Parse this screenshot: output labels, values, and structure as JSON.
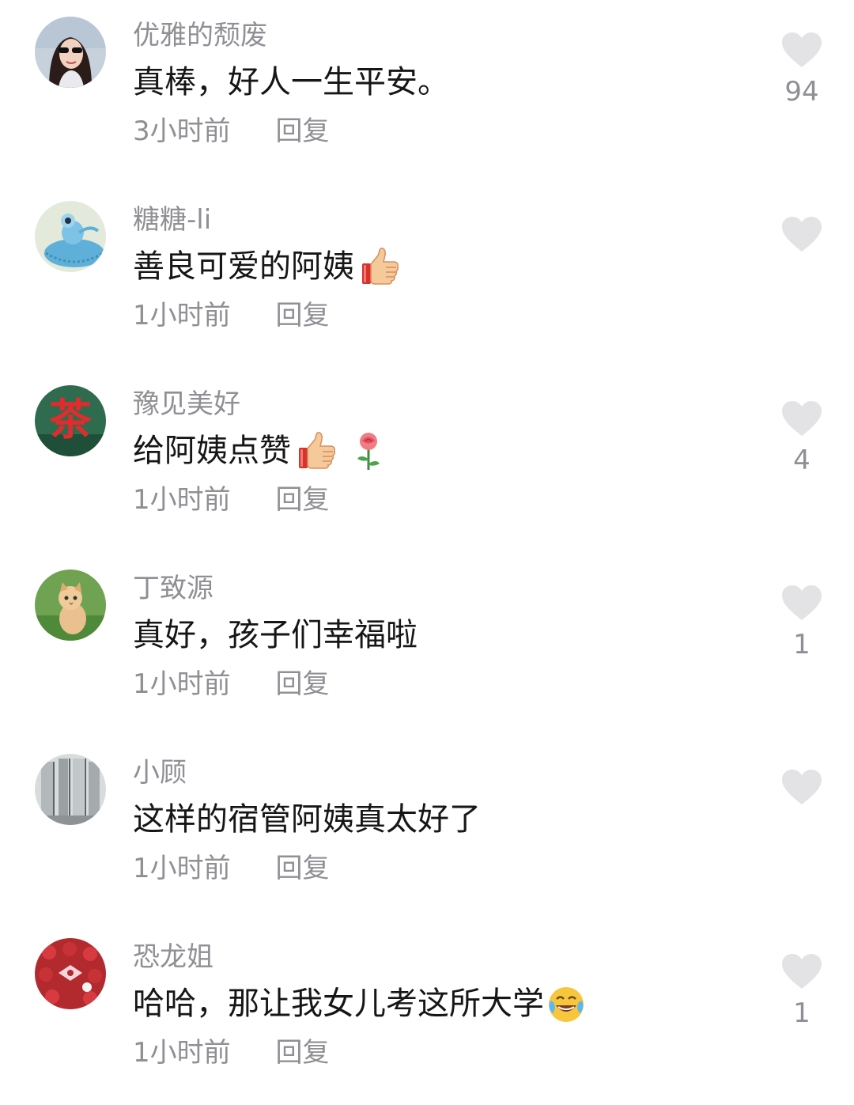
{
  "comments": [
    {
      "username": "优雅的颓废",
      "text": "真棒，好人一生平安。",
      "time": "3小时前",
      "reply": "回复",
      "likes": "94"
    },
    {
      "username": "糖糖-li",
      "text": "善良可爱的阿姨",
      "time": "1小时前",
      "reply": "回复",
      "likes": ""
    },
    {
      "username": "豫见美好",
      "text": "给阿姨点赞",
      "time": "1小时前",
      "reply": "回复",
      "likes": "4"
    },
    {
      "username": "丁致源",
      "text": "真好，孩子们幸福啦",
      "time": "1小时前",
      "reply": "回复",
      "likes": "1"
    },
    {
      "username": "小顾",
      "text": "这样的宿管阿姨真太好了",
      "time": "1小时前",
      "reply": "回复",
      "likes": ""
    },
    {
      "username": "恐龙姐",
      "text": "哈哈，那让我女儿考这所大学",
      "time": "1小时前",
      "reply": "回复",
      "likes": "1"
    }
  ],
  "avatar_text": {
    "tea": "茶"
  },
  "icons": {
    "like": "heart-icon",
    "thumbs_up": "thumbs-up-emoji",
    "rose": "rose-emoji",
    "laughing": "tears-of-joy-emoji"
  },
  "colors": {
    "text_primary": "#161616",
    "text_secondary": "#8f8f94",
    "heart": "#e3e3e6"
  }
}
